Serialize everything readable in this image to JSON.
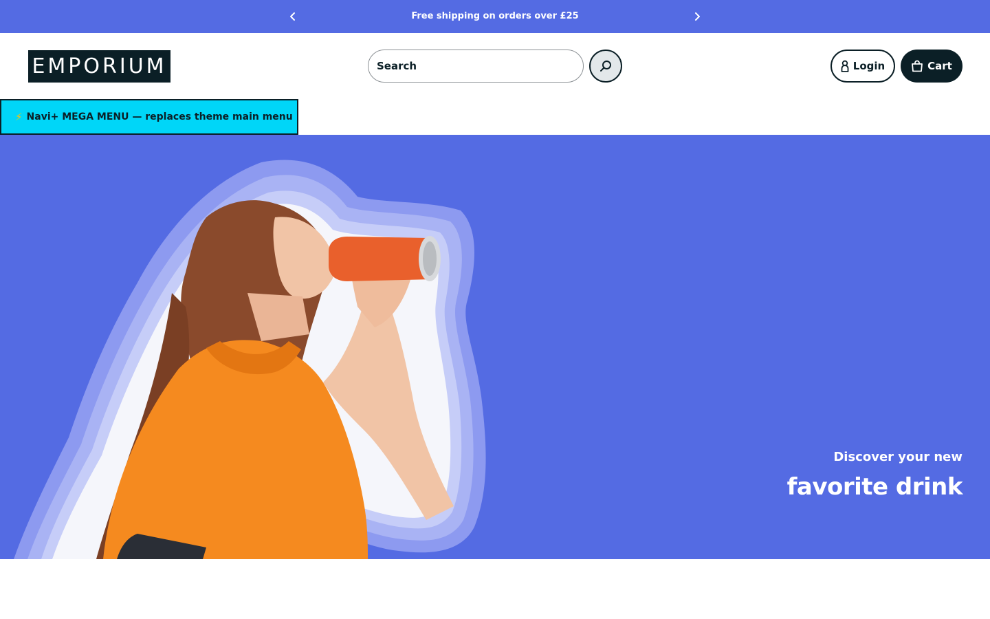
{
  "announcement": {
    "message": "Free shipping on orders over £25",
    "prev_icon": "chevron-left-icon",
    "next_icon": "chevron-right-icon"
  },
  "header": {
    "logo_text": "EMPORIUM",
    "search": {
      "placeholder": "Search",
      "value": "",
      "button_icon": "search-icon"
    },
    "login_label": "Login",
    "login_icon": "user-icon",
    "cart_label": "Cart",
    "cart_icon": "shopping-bag-icon"
  },
  "mega_menu": {
    "icon": "lightning-icon",
    "label": "Navi+ MEGA MENU — replaces theme main menu"
  },
  "hero": {
    "subtitle": "Discover your new",
    "title": "favorite drink",
    "image": "woman drinking from orange can"
  },
  "colors": {
    "brand_blue": "#546be3",
    "dark": "#0b1f26",
    "mega_cyan": "#00d6f8",
    "white": "#ffffff"
  }
}
